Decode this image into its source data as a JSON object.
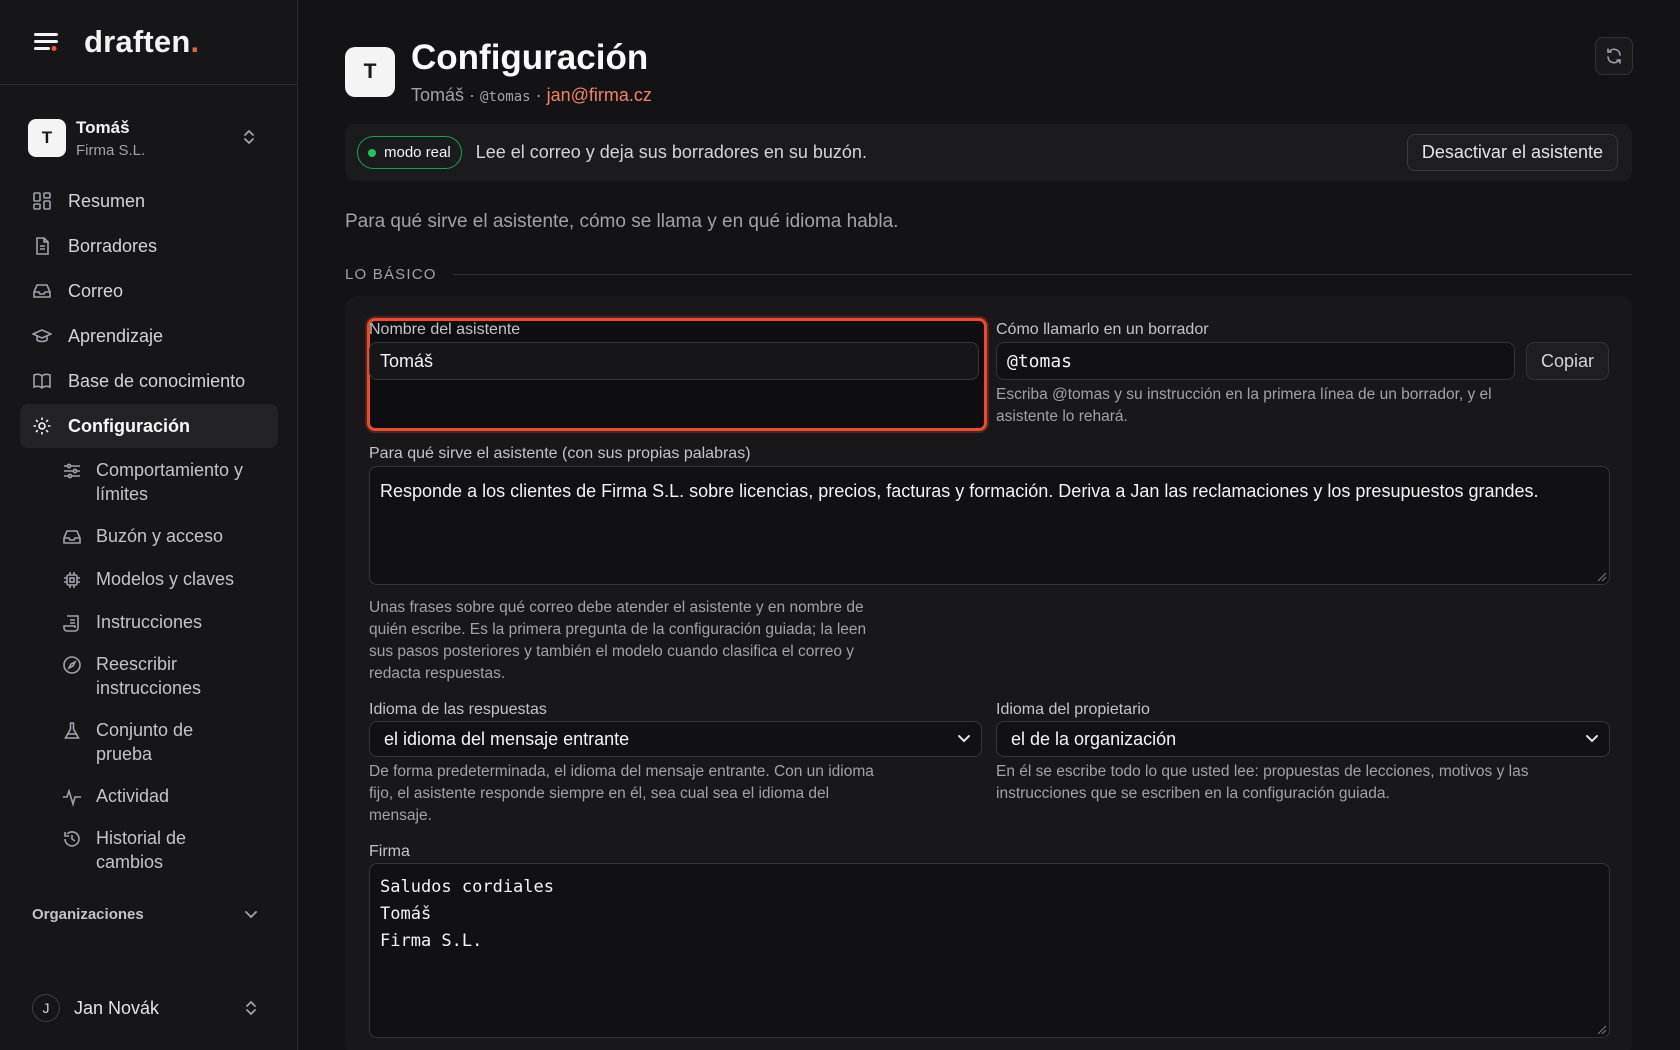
{
  "app": {
    "brand": "draften",
    "brand_dot": "."
  },
  "tenant": {
    "initial": "T",
    "name": "Tomáš",
    "org": "Firma S.L."
  },
  "nav": {
    "items": [
      {
        "label": "Resumen",
        "icon": "grid-icon"
      },
      {
        "label": "Borradores",
        "icon": "document-icon"
      },
      {
        "label": "Correo",
        "icon": "inbox-icon"
      },
      {
        "label": "Aprendizaje",
        "icon": "graduation-cap-icon"
      },
      {
        "label": "Base de conocimiento",
        "icon": "book-icon"
      },
      {
        "label": "Configuración",
        "icon": "gear-icon",
        "active": true
      }
    ],
    "sub_items": [
      {
        "label": "Comportamiento y límites",
        "icon": "sliders-icon"
      },
      {
        "label": "Buzón y acceso",
        "icon": "inbox-icon"
      },
      {
        "label": "Modelos y claves",
        "icon": "chip-icon"
      },
      {
        "label": "Instrucciones",
        "icon": "scroll-icon"
      },
      {
        "label": "Reescribir instrucciones",
        "icon": "compass-icon"
      },
      {
        "label": "Conjunto de prueba",
        "icon": "flask-icon"
      },
      {
        "label": "Actividad",
        "icon": "activity-icon"
      },
      {
        "label": "Historial de cambios",
        "icon": "history-icon"
      }
    ],
    "orgs_label": "Organizaciones"
  },
  "user": {
    "initial": "J",
    "name": "Jan Novák"
  },
  "header": {
    "initial": "T",
    "title": "Configuración",
    "sub_name": "Tomáš",
    "sub_sep": " · ",
    "sub_handle": "@tomas",
    "sub_email": "jan@firma.cz"
  },
  "banner": {
    "badge": "modo real",
    "text": "Lee el correo y deja sus borradores en su buzón.",
    "button": "Desactivar el asistente"
  },
  "intro": "Para qué sirve el asistente, cómo se llama y en qué idioma habla.",
  "section_title": "LO BÁSICO",
  "form": {
    "name_label": "Nombre del asistente",
    "name_value": "Tomáš",
    "call_label": "Cómo llamarlo en un borrador",
    "call_value": "@tomas",
    "copy_button": "Copiar",
    "call_help": "Escriba @tomas y su instrucción en la primera línea de un borrador, y el asistente lo rehará.",
    "purpose_label": "Para qué sirve el asistente (con sus propias palabras)",
    "purpose_value": "Responde a los clientes de Firma S.L. sobre licencias, precios, facturas y formación. Deriva a Jan las reclamaciones y los presupuestos grandes.",
    "purpose_help": "Unas frases sobre qué correo debe atender el asistente y en nombre de quién escribe. Es la primera pregunta de la configuración guiada; la leen sus pasos posteriores y también el modelo cuando clasifica el correo y redacta respuestas.",
    "reply_lang_label": "Idioma de las respuestas",
    "reply_lang_value": "el idioma del mensaje entrante",
    "reply_lang_help": "De forma predeterminada, el idioma del mensaje entrante. Con un idioma fijo, el asistente responde siempre en él, sea cual sea el idioma del mensaje.",
    "owner_lang_label": "Idioma del propietario",
    "owner_lang_value": "el de la organización",
    "owner_lang_help": "En él se escribe todo lo que usted lee: propuestas de lecciones, motivos y las instrucciones que se escriben en la configuración guiada.",
    "signature_label": "Firma",
    "signature_lines": [
      "Saludos cordiales",
      "Tomáš",
      "Firma S.L."
    ]
  },
  "colors": {
    "accent": "#ef4a2e",
    "live": "#22c55e",
    "email": "#f0826a"
  }
}
